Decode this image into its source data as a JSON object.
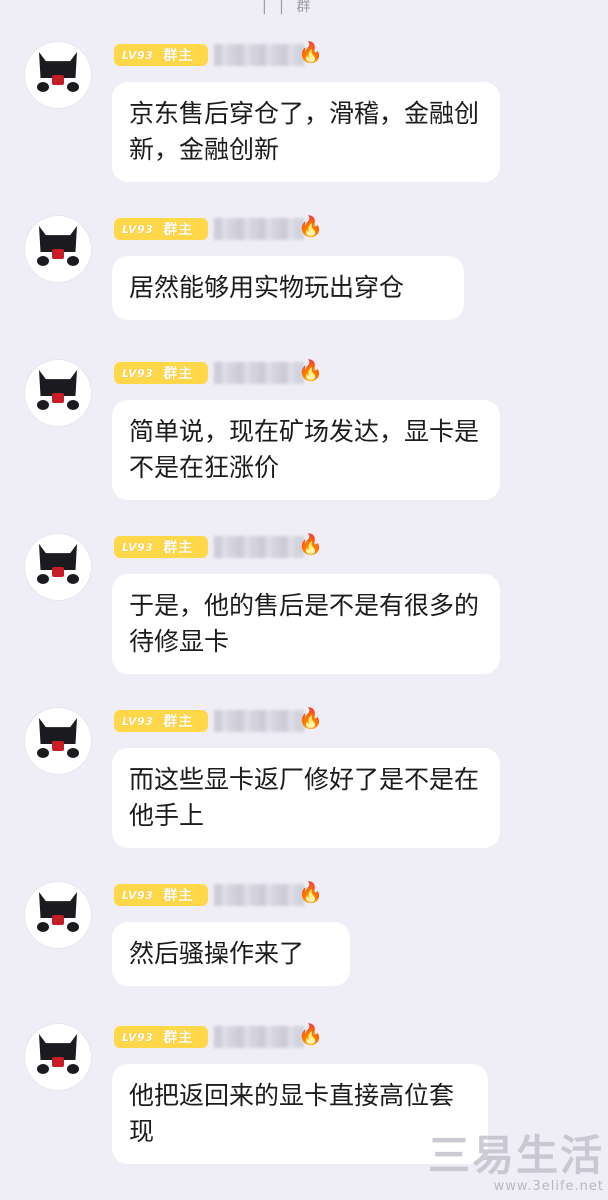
{
  "top_partial_text": "| | 群",
  "messages": [
    {
      "level": "LV93",
      "role": "群主",
      "text": "京东售后穿仓了，滑稽，金融创新，金融创新"
    },
    {
      "level": "LV93",
      "role": "群主",
      "text": "居然能够用实物玩出穿仓"
    },
    {
      "level": "LV93",
      "role": "群主",
      "text": "简单说，现在矿场发达，显卡是不是在狂涨价"
    },
    {
      "level": "LV93",
      "role": "群主",
      "text": "于是，他的售后是不是有很多的待修显卡"
    },
    {
      "level": "LV93",
      "role": "群主",
      "text": "而这些显卡返厂修好了是不是在他手上"
    },
    {
      "level": "LV93",
      "role": "群主",
      "text": "然后骚操作来了"
    },
    {
      "level": "LV93",
      "role": "群主",
      "text": "他把返回来的显卡直接高位套现"
    }
  ],
  "icons": {
    "fire": "fire-icon",
    "avatar": "cat-avatar"
  },
  "watermark": {
    "text": "三易生活",
    "url": "www.3elife.net"
  },
  "colors": {
    "background": "#efeef6",
    "badge": "#ffd84a",
    "bubble": "#ffffff"
  }
}
